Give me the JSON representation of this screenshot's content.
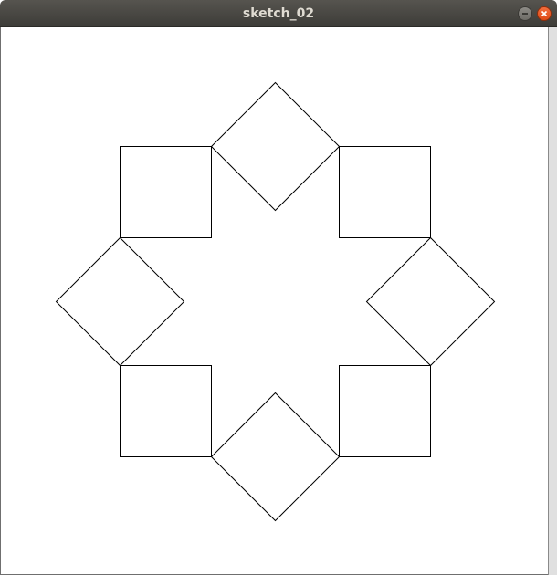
{
  "window": {
    "title": "sketch_02"
  },
  "icons": {
    "minimize": "minimize-icon",
    "close": "close-icon"
  },
  "colors": {
    "titlebar": "#45433f",
    "close_button": "#e95420",
    "canvas_background": "#ffffff",
    "stroke": "#000000"
  }
}
